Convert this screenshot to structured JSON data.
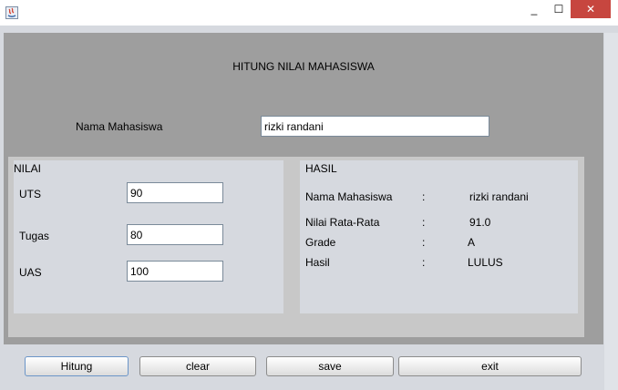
{
  "window": {
    "minimize_glyph": "_",
    "maximize_glyph": "☐",
    "close_glyph": "✕"
  },
  "form": {
    "heading": "HITUNG NILAI MAHASISWA",
    "name_label": "Nama Mahasiswa",
    "name_value": "rizki randani"
  },
  "nilai": {
    "title": "NILAI",
    "uts_label": "UTS",
    "uts_value": "90",
    "tugas_label": "Tugas",
    "tugas_value": "80",
    "uas_label": "UAS",
    "uas_value": "100"
  },
  "hasil": {
    "title": "HASIL",
    "separator": ":",
    "rows": [
      {
        "label": "Nama Mahasiswa",
        "value": "rizki randani"
      },
      {
        "label": "Nilai Rata-Rata",
        "value": "91.0"
      },
      {
        "label": "Grade",
        "value": "A"
      },
      {
        "label": "Hasil",
        "value": "LULUS"
      }
    ]
  },
  "buttons": {
    "hitung": "Hitung",
    "clear": "clear",
    "save": "save",
    "exit": "exit"
  },
  "colors": {
    "panel_gray": "#9e9e9e",
    "close_red": "#c7463f",
    "focus_blue": "#6b95c8"
  }
}
